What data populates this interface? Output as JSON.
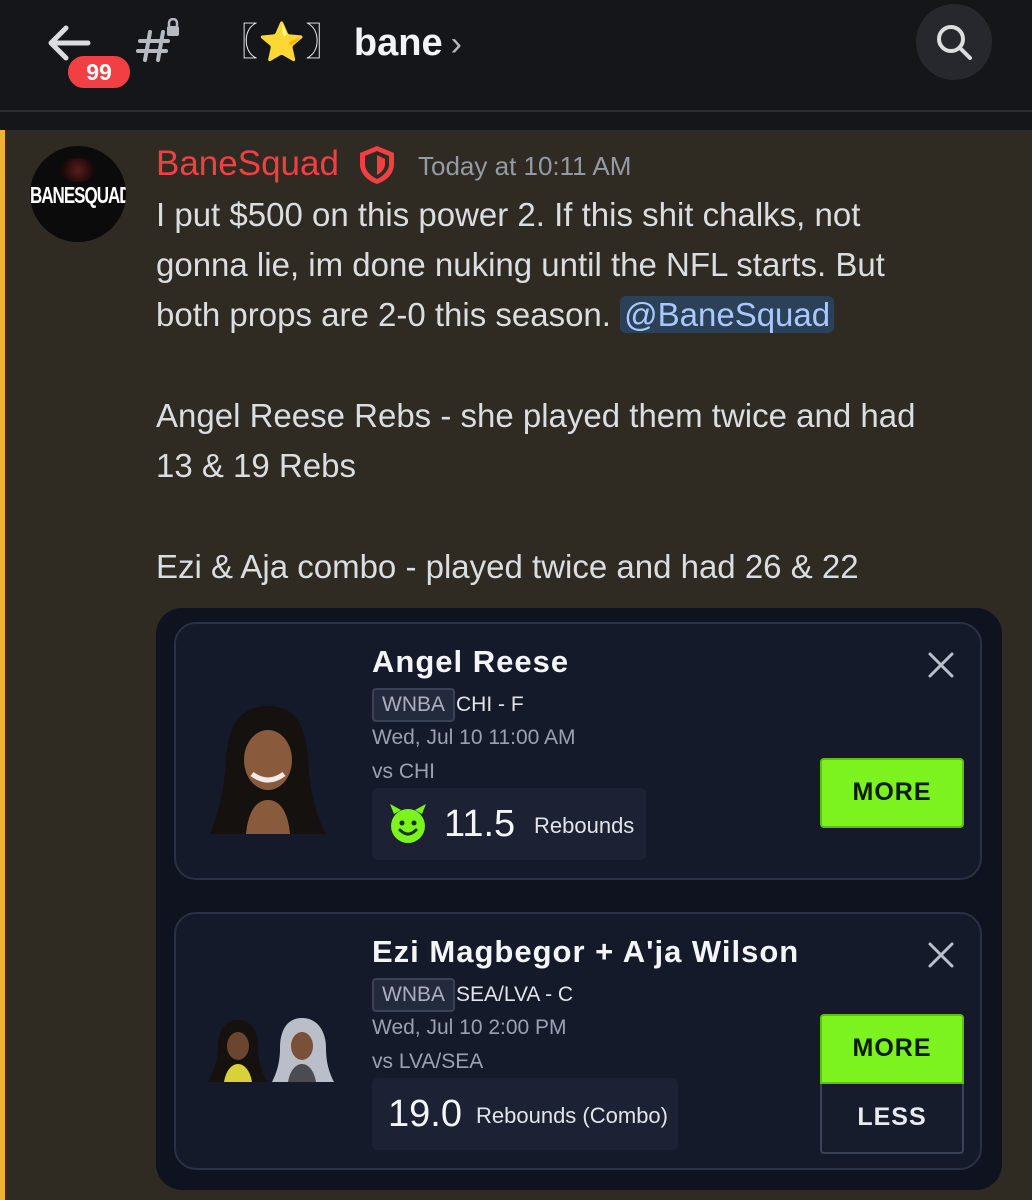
{
  "header": {
    "back_label": "Back",
    "unread_badge": "99",
    "channel_prefix": "〖",
    "channel_emoji": "⭐",
    "channel_suffix": "〗",
    "channel_name": "bane",
    "channel_chevron": "›"
  },
  "message": {
    "avatar_text": "BANESQUAD",
    "author": "BaneSquad",
    "timestamp": "Today at 10:11 AM",
    "lines": [
      "I put $500 on this power 2. If this shit chalks, not",
      "gonna lie, im done nuking until the NFL starts. But",
      "both props are 2-0 this season. "
    ],
    "mention": "@BaneSquad",
    "para2_lines": [
      "Angel Reese Rebs - she played them twice and had",
      "13 & 19 Rebs"
    ],
    "para3_lines": [
      "Ezi & Aja combo - played twice and had 26 & 22"
    ]
  },
  "picks": [
    {
      "player": "Angel Reese",
      "league": "WNBA",
      "team_position": "CHI - F",
      "game_time": "Wed, Jul 10 11:00 AM",
      "opponent": "vs CHI",
      "line": "11.5",
      "stat": "Rebounds",
      "more_label": "MORE"
    },
    {
      "player": "Ezi Magbegor + A'ja Wilson",
      "league": "WNBA",
      "team_position": "SEA/LVA - C",
      "game_time": "Wed, Jul 10 2:00 PM",
      "opponent": "vs LVA/SEA",
      "line": "19.0",
      "stat": "Rebounds (Combo)",
      "more_label": "MORE",
      "less_label": "LESS"
    }
  ],
  "colors": {
    "author": "#f23f43",
    "highlight": "#f0b232",
    "more_button": "#7cf21e",
    "badge": "#f23f43"
  }
}
